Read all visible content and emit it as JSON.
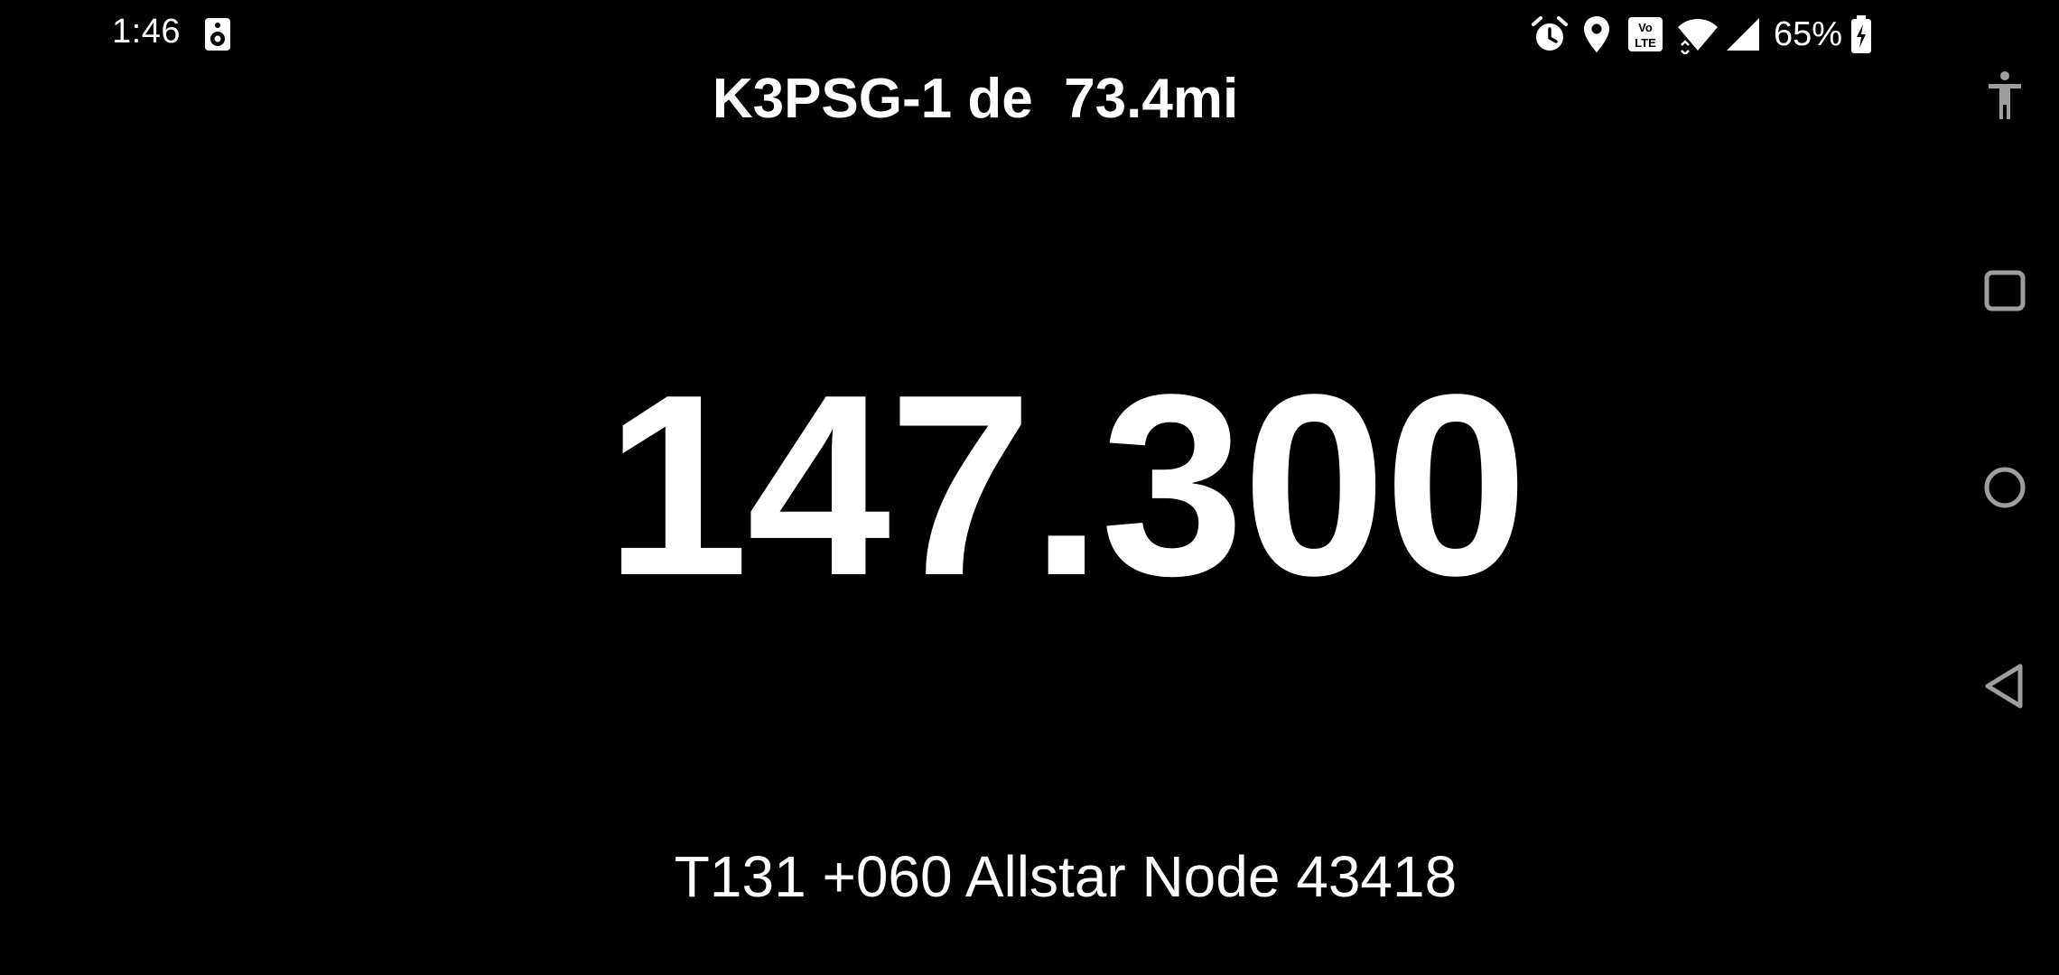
{
  "status_bar": {
    "time": "1:46",
    "battery_percent": "65%",
    "icons": [
      "speaker-icon",
      "alarm-icon",
      "location-icon",
      "volte-icon",
      "wifi-icon",
      "cellular-signal-icon",
      "battery-charging-icon"
    ]
  },
  "app": {
    "station_title": "K3PSG-1 de  73.4mi",
    "frequency": "147.300",
    "details": "T131 +060 Allstar Node 43418"
  },
  "nav_bar": {
    "buttons": [
      "accessibility-icon",
      "recents-icon",
      "home-icon",
      "back-icon"
    ]
  },
  "colors": {
    "background": "#000000",
    "text": "#ffffff",
    "nav_icon": "#9e9e9e"
  }
}
